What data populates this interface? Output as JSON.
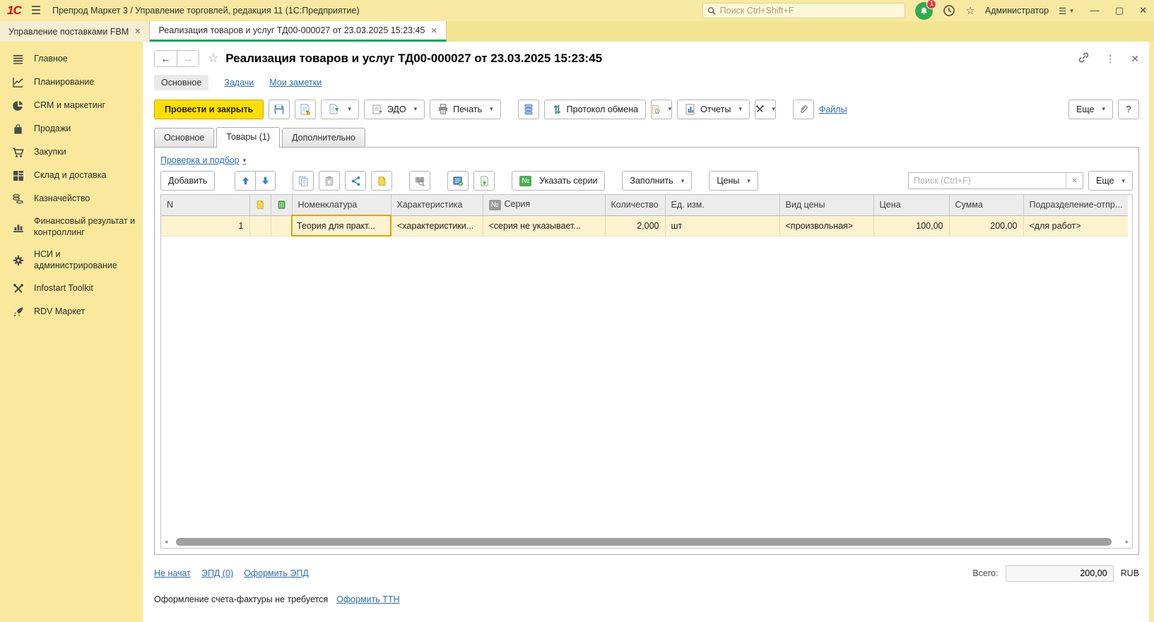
{
  "titlebar": {
    "logo": "1С",
    "app_title": "Препрод Маркет 3 / Управление торговлей, редакция 11  (1С:Предприятие)",
    "search_placeholder": "Поиск Ctrl+Shift+F",
    "notification_count": "1",
    "user": "Администратор"
  },
  "window_tabs": [
    {
      "label": "Управление поставками FBM",
      "close": "✕"
    },
    {
      "label": "Реализация товаров и услуг ТД00-000027 от 23.03.2025 15:23:45",
      "close": "✕"
    }
  ],
  "sidebar": {
    "items": [
      {
        "label": "Главное",
        "icon": "menu-icon"
      },
      {
        "label": "Планирование",
        "icon": "planning-chart-icon"
      },
      {
        "label": "CRM и маркетинг",
        "icon": "pie-chart-icon"
      },
      {
        "label": "Продажи",
        "icon": "shopping-bag-icon"
      },
      {
        "label": "Закупки",
        "icon": "shopping-cart-icon"
      },
      {
        "label": "Склад и доставка",
        "icon": "warehouse-grid-icon"
      },
      {
        "label": "Казначейство",
        "icon": "coins-icon"
      },
      {
        "label": "Финансовый результат и контроллинг",
        "icon": "bar-chart-icon"
      },
      {
        "label": "НСИ и администрирование",
        "icon": "gear-icon"
      },
      {
        "label": "Infostart Toolkit",
        "icon": "tools-icon"
      },
      {
        "label": "RDV Маркет",
        "icon": "rocket-icon"
      }
    ]
  },
  "form": {
    "title": "Реализация товаров и услуг ТД00-000027 от 23.03.2025 15:23:45",
    "nav_links": [
      "Основное",
      "Задачи",
      "Мои заметки"
    ],
    "command_bar": {
      "post_close": "Провести и закрыть",
      "edo": "ЭДО",
      "print": "Печать",
      "protocol": "Протокол обмена",
      "reports": "Отчеты",
      "files": "Файлы",
      "more": "Еще",
      "help": "?"
    },
    "tabs": [
      "Основное",
      "Товары (1)",
      "Дополнительно"
    ],
    "check_pick_link": "Проверка и подбор",
    "table_toolbar": {
      "add": "Добавить",
      "series_badge": "№",
      "set_series": "Указать серии",
      "fill": "Заполнить",
      "prices": "Цены",
      "search_placeholder": "Поиск (Ctrl+F)",
      "more": "Еще"
    },
    "table": {
      "series_header_badge": "№",
      "columns": [
        "N",
        "Номенклатура",
        "Характеристика",
        "Серия",
        "Количество",
        "Ед. изм.",
        "Вид цены",
        "Цена",
        "Сумма",
        "Подразделение-отпр..."
      ],
      "rows": [
        {
          "n": "1",
          "nomenclature": "Теория для практ...",
          "characteristic": "<характеристики...",
          "series": "<серия не указывает...",
          "quantity": "2,000",
          "unit": "шт",
          "price_type": "<произвольная>",
          "price": "100,00",
          "sum": "200,00",
          "department": "<для работ>"
        }
      ]
    },
    "footer": {
      "status_link": "Не начат",
      "epd_link": "ЭПД (0)",
      "epd_create_link": "Оформить ЭПД",
      "total_label": "Всего:",
      "total_value": "200,00",
      "currency": "RUB",
      "invoice_note": "Оформление счета-фактуры не требуется",
      "ttn_link": "Оформить ТТН"
    }
  },
  "colors": {
    "accent_yellow": "#f8e9a2",
    "primary_button": "#ffdf00",
    "active_tab_green": "#00a651",
    "link_blue": "#2a6db5",
    "row_highlight": "#fcf2cf",
    "selected_cell_border": "#e0a400"
  }
}
